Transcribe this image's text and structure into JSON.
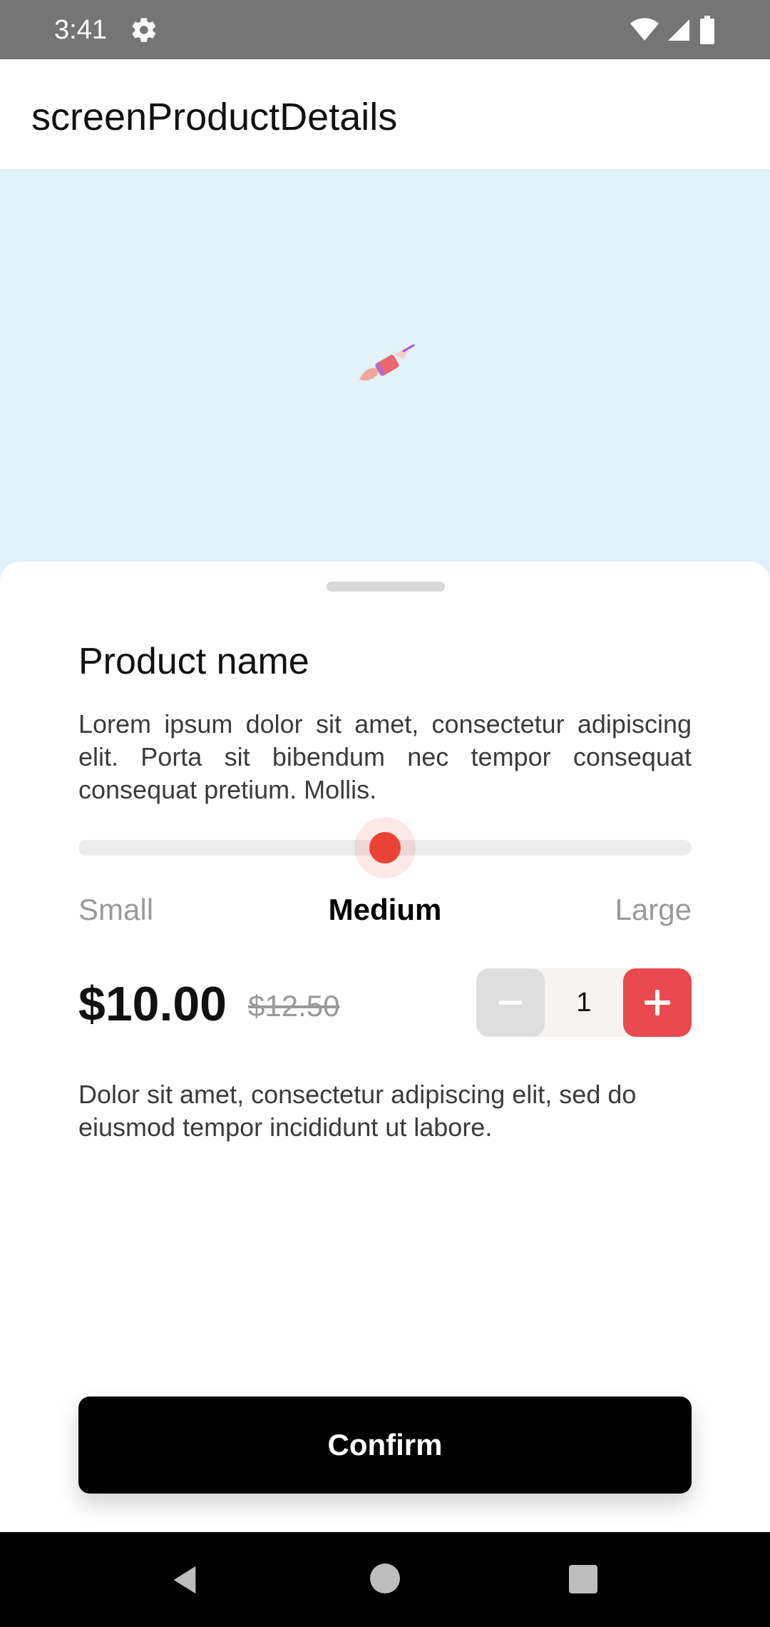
{
  "status_bar": {
    "time": "3:41",
    "icons": [
      "settings-icon",
      "wifi-icon",
      "signal-icon",
      "battery-icon"
    ]
  },
  "app_bar": {
    "title": "screenProductDetails"
  },
  "hero": {
    "background_color": "#e0f1f8",
    "icon": "brush-icon"
  },
  "product": {
    "name": "Product name",
    "description": "Lorem ipsum dolor sit amet, consectetur adipiscing elit. Porta sit bibendum nec tempor consequat consequat pretium. Mollis.",
    "size_options": [
      "Small",
      "Medium",
      "Large"
    ],
    "selected_size": "Medium",
    "price": "$10.00",
    "original_price": "$12.50",
    "quantity": "1",
    "note": "Dolor sit amet, consectetur adipiscing elit, sed do eiusmod tempor incididunt ut labore."
  },
  "actions": {
    "confirm_label": "Confirm"
  },
  "colors": {
    "accent": "#ea4335",
    "plus_button": "#e84a4f",
    "primary_button": "#000000"
  },
  "nav_bar": {
    "icons": [
      "back-icon",
      "home-icon",
      "recents-icon"
    ]
  }
}
